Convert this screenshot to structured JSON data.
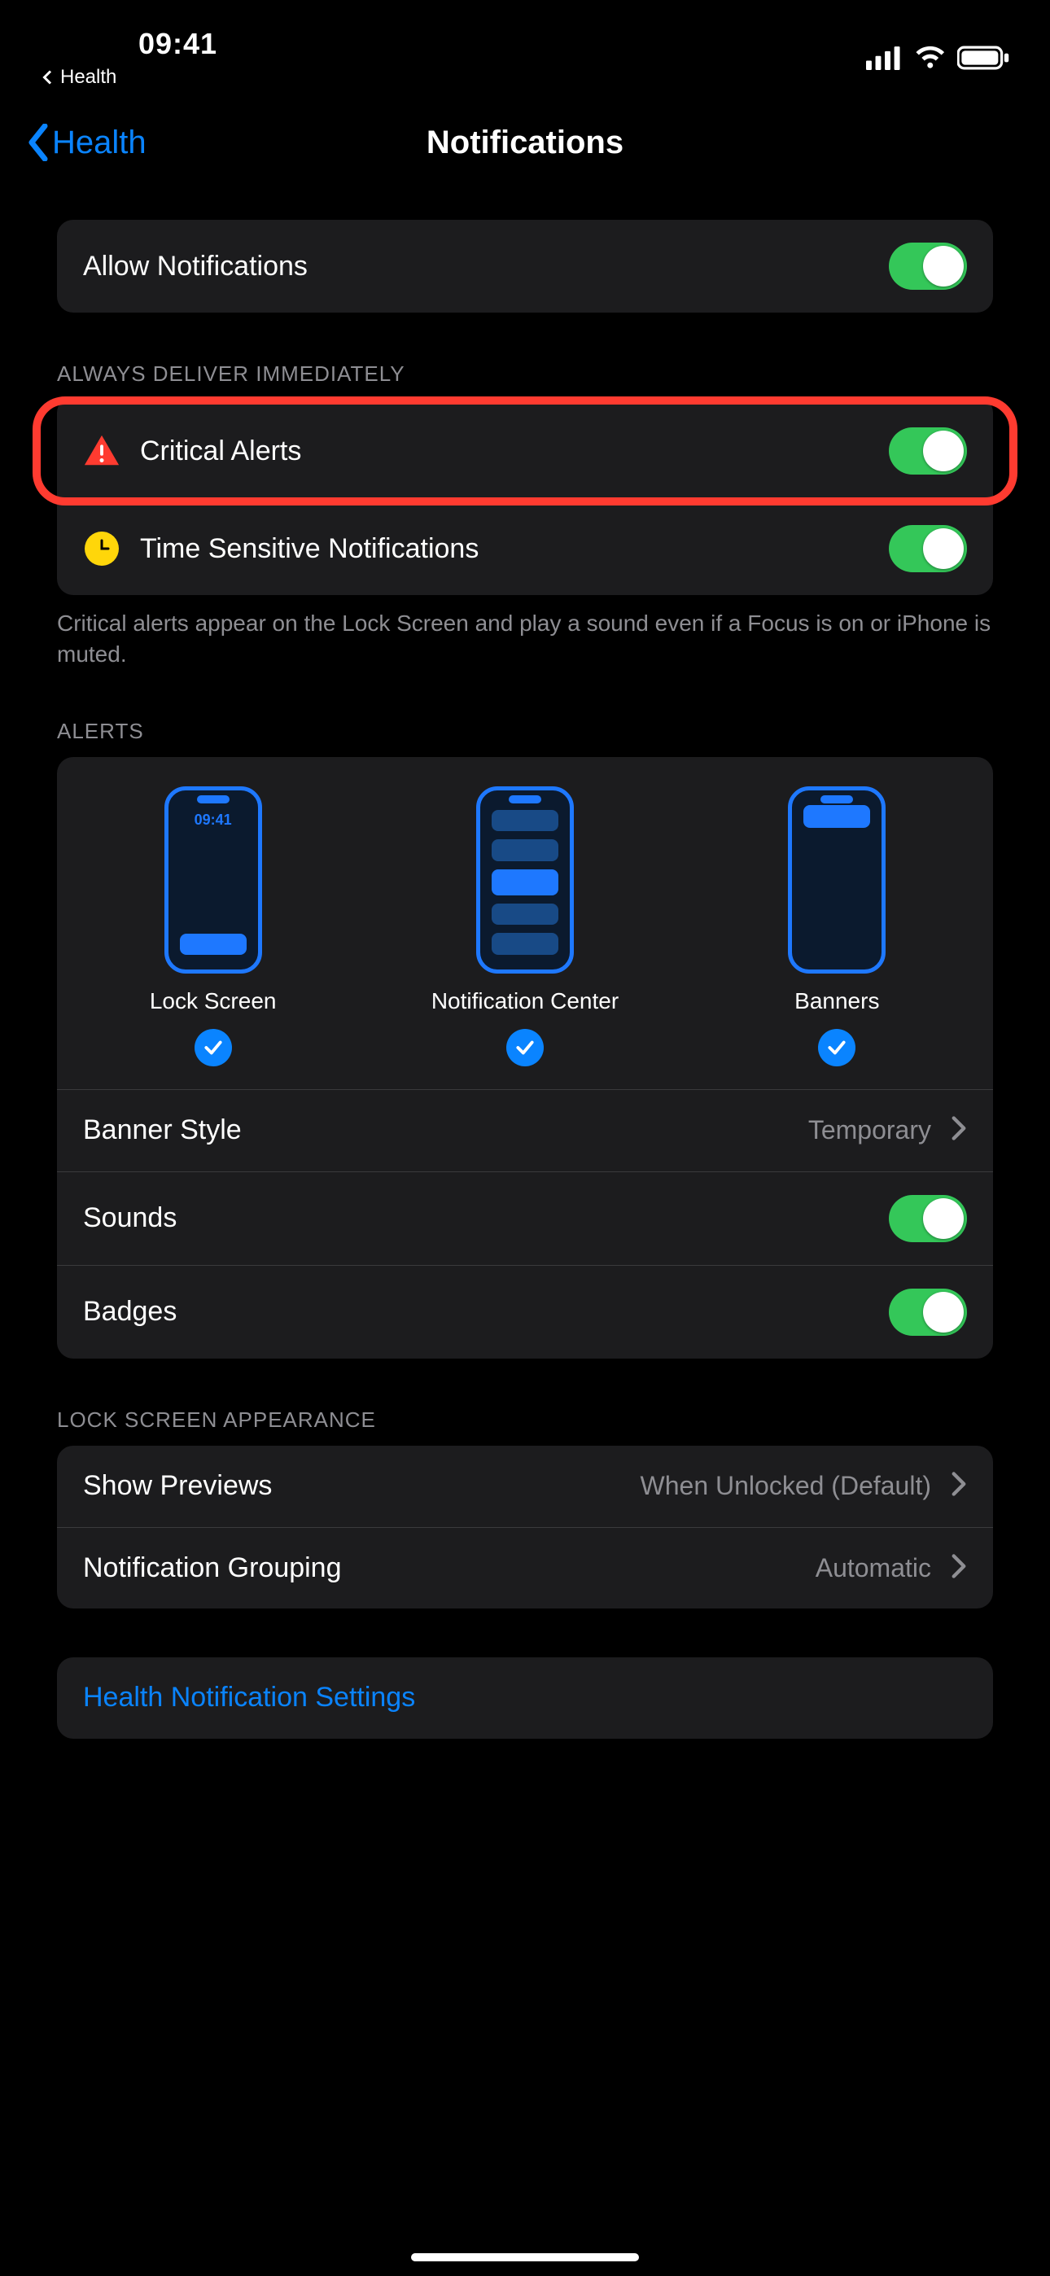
{
  "statusbar": {
    "time": "09:41",
    "back_app": "Health"
  },
  "nav": {
    "back_label": "Health",
    "title": "Notifications"
  },
  "allow": {
    "label": "Allow Notifications",
    "on": true
  },
  "deliver": {
    "header": "ALWAYS DELIVER IMMEDIATELY",
    "critical": {
      "label": "Critical Alerts",
      "on": true
    },
    "time_sensitive": {
      "label": "Time Sensitive Notifications",
      "on": true
    },
    "footer": "Critical alerts appear on the Lock Screen and play a sound even if a Focus is on or iPhone is muted."
  },
  "alerts": {
    "header": "ALERTS",
    "preview_time": "09:41",
    "lock_label": "Lock Screen",
    "center_label": "Notification Center",
    "banner_label": "Banners",
    "banner_style": {
      "label": "Banner Style",
      "value": "Temporary"
    },
    "sounds": {
      "label": "Sounds",
      "on": true
    },
    "badges": {
      "label": "Badges",
      "on": true
    }
  },
  "ls_appearance": {
    "header": "LOCK SCREEN APPEARANCE",
    "previews": {
      "label": "Show Previews",
      "value": "When Unlocked (Default)"
    },
    "grouping": {
      "label": "Notification Grouping",
      "value": "Automatic"
    }
  },
  "health_link": {
    "label": "Health Notification Settings"
  }
}
